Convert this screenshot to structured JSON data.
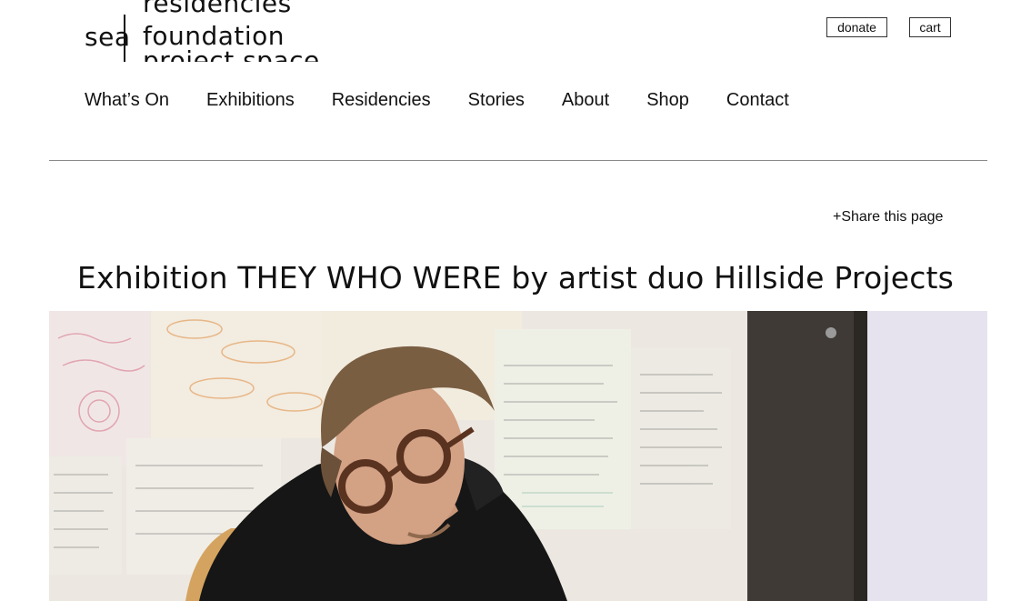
{
  "logo": {
    "left_text": "sea",
    "lines": [
      "residencies",
      "foundation",
      "project space"
    ]
  },
  "header": {
    "donate_label": "donate",
    "cart_label": "cart"
  },
  "nav": {
    "items": [
      {
        "label": "What’s On"
      },
      {
        "label": "Exhibitions"
      },
      {
        "label": "Residencies"
      },
      {
        "label": "Stories"
      },
      {
        "label": "About"
      },
      {
        "label": "Shop"
      },
      {
        "label": "Contact"
      }
    ]
  },
  "share": {
    "label": "+Share this page"
  },
  "page": {
    "title": "Exhibition THEY WHO WERE by artist duo Hillside Projects"
  },
  "colors": {
    "text": "#111111",
    "divider": "#8a8a8a",
    "background": "#ffffff"
  }
}
